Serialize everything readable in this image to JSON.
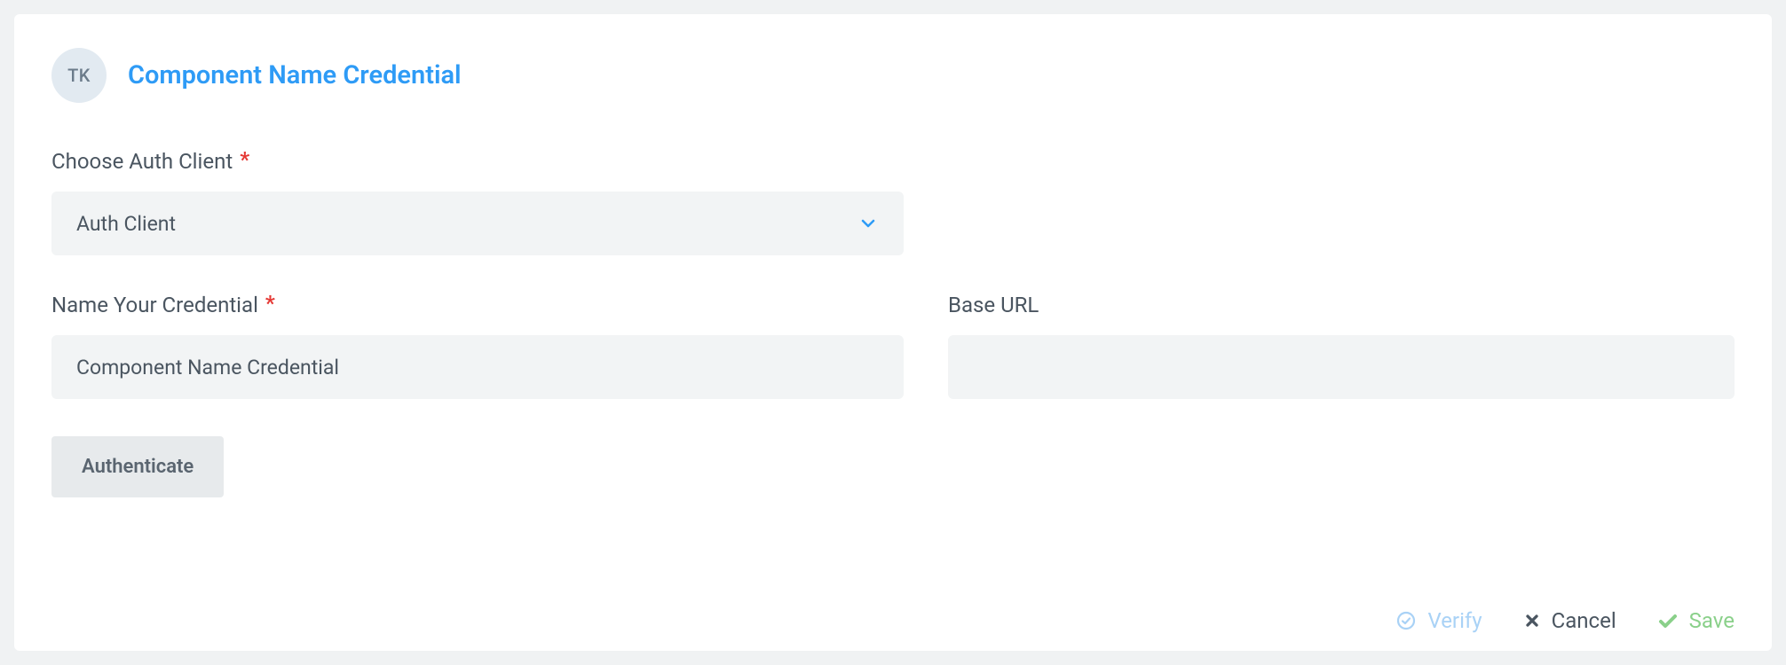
{
  "header": {
    "avatar_initials": "TK",
    "title": "Component Name Credential"
  },
  "form": {
    "auth_client": {
      "label": "Choose Auth Client",
      "selected": "Auth Client"
    },
    "credential_name": {
      "label": "Name Your Credential",
      "value": "Component Name Credential"
    },
    "base_url": {
      "label": "Base URL",
      "value": ""
    },
    "authenticate_label": "Authenticate"
  },
  "footer": {
    "verify_label": "Verify",
    "cancel_label": "Cancel",
    "save_label": "Save"
  }
}
